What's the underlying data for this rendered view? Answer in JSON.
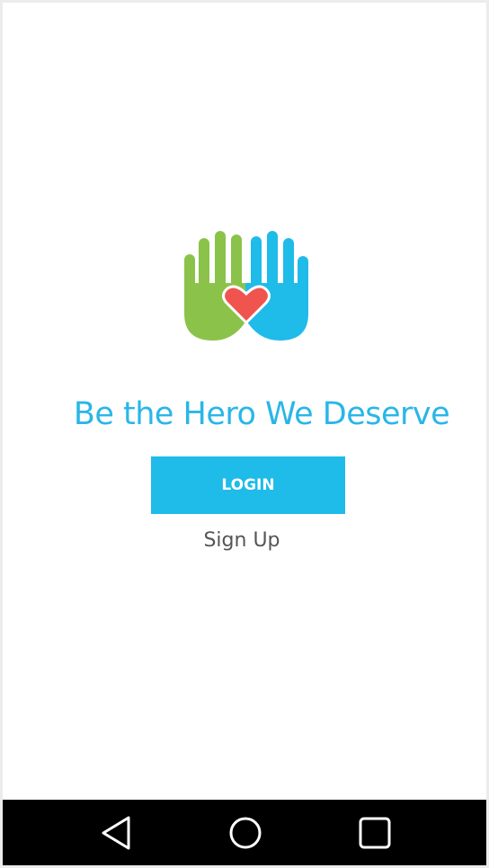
{
  "app": {
    "tagline": "Be the Hero We Deserve",
    "logo_icon": "hands-heart-icon"
  },
  "actions": {
    "login_label": "LOGIN",
    "signup_label": "Sign Up"
  },
  "navigation": {
    "back_icon": "back-triangle-icon",
    "home_icon": "home-circle-icon",
    "recents_icon": "recents-square-icon"
  },
  "colors": {
    "accent": "#1fbbe9",
    "green_hand": "#8bc34a",
    "blue_hand": "#1fbbe9",
    "heart": "#f0544f"
  }
}
